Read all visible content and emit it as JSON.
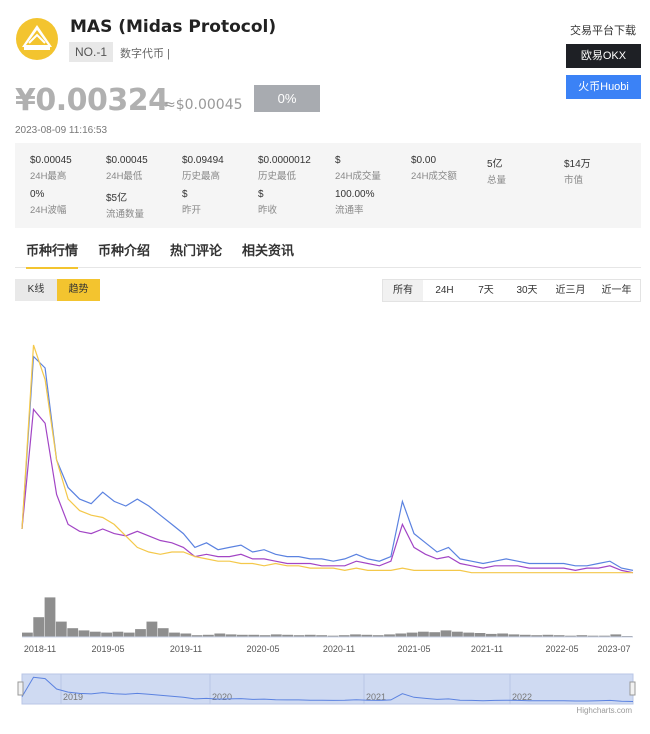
{
  "header": {
    "title": "MAS (Midas Protocol)",
    "rank": "NO.-1",
    "category": "数字代币 |"
  },
  "exchange": {
    "title": "交易平台下载",
    "okx": "欧易OKX",
    "huobi": "火币Huobi"
  },
  "price": {
    "cny": "¥0.00324",
    "usd": "≈$0.00045",
    "change": "0%",
    "timestamp": "2023-08-09 11:16:53"
  },
  "stats": [
    {
      "value": "$0.00045",
      "label": "24H最高"
    },
    {
      "value": "$0.00045",
      "label": "24H最低"
    },
    {
      "value": "$0.09494",
      "label": "历史最高"
    },
    {
      "value": "$0.0000012",
      "label": "历史最低"
    },
    {
      "value": "$",
      "label": "24H成交量"
    },
    {
      "value": "$0.00",
      "label": "24H成交额"
    },
    {
      "value": "5亿",
      "label": "总量"
    },
    {
      "value": "$14万",
      "label": "市值"
    },
    {
      "value": "0%",
      "label": "24H波幅"
    },
    {
      "value": "$5亿",
      "label": "流通数量"
    },
    {
      "value": "$",
      "label": "昨开"
    },
    {
      "value": "$",
      "label": "昨收"
    },
    {
      "value": "100.00%",
      "label": "流通率"
    }
  ],
  "tabs": [
    "币种行情",
    "币种介绍",
    "热门评论",
    "相关资讯"
  ],
  "controls": {
    "kline": "K线",
    "trend": "趋势",
    "ranges": [
      "所有",
      "24H",
      "7天",
      "30天",
      "近三月",
      "近一年"
    ]
  },
  "chart_data": {
    "type": "line",
    "x_tick_labels": [
      "2018-11",
      "2019-05",
      "2019-11",
      "2020-05",
      "2020-11",
      "2021-05",
      "2021-11",
      "2022-05",
      "2023-07"
    ],
    "navigator_labels": [
      "2019",
      "2020",
      "2021",
      "2022"
    ],
    "credit": "Highcharts.com",
    "colors": {
      "line1": "#5b82e0",
      "line2": "#a245c5",
      "line3": "#f4c84a",
      "volume": "#8e8e8e",
      "navigator": "#cfdaf2"
    },
    "series": [
      {
        "values": [
          0.2,
          0.95,
          0.9,
          0.5,
          0.38,
          0.33,
          0.31,
          0.36,
          0.32,
          0.3,
          0.33,
          0.3,
          0.26,
          0.22,
          0.18,
          0.12,
          0.14,
          0.11,
          0.12,
          0.13,
          0.1,
          0.11,
          0.09,
          0.08,
          0.08,
          0.07,
          0.07,
          0.06,
          0.07,
          0.09,
          0.07,
          0.06,
          0.08,
          0.32,
          0.18,
          0.14,
          0.1,
          0.12,
          0.07,
          0.06,
          0.05,
          0.06,
          0.07,
          0.06,
          0.05,
          0.05,
          0.05,
          0.05,
          0.04,
          0.04,
          0.05,
          0.06,
          0.03,
          0.02
        ]
      },
      {
        "values": [
          0.2,
          0.72,
          0.66,
          0.35,
          0.22,
          0.19,
          0.18,
          0.2,
          0.18,
          0.17,
          0.19,
          0.17,
          0.15,
          0.14,
          0.12,
          0.08,
          0.09,
          0.08,
          0.08,
          0.09,
          0.07,
          0.07,
          0.06,
          0.05,
          0.05,
          0.05,
          0.04,
          0.04,
          0.04,
          0.06,
          0.05,
          0.04,
          0.06,
          0.22,
          0.12,
          0.09,
          0.07,
          0.08,
          0.05,
          0.04,
          0.03,
          0.04,
          0.04,
          0.04,
          0.03,
          0.03,
          0.03,
          0.03,
          0.02,
          0.03,
          0.03,
          0.04,
          0.02,
          0.01
        ]
      },
      {
        "values": [
          0.2,
          1.0,
          0.85,
          0.5,
          0.33,
          0.28,
          0.26,
          0.25,
          0.22,
          0.17,
          0.12,
          0.1,
          0.09,
          0.1,
          0.1,
          0.08,
          0.07,
          0.06,
          0.06,
          0.05,
          0.05,
          0.04,
          0.05,
          0.04,
          0.04,
          0.03,
          0.03,
          0.03,
          0.02,
          0.03,
          0.02,
          0.02,
          0.02,
          0.03,
          0.02,
          0.02,
          0.02,
          0.02,
          0.02,
          0.01,
          0.01,
          0.01,
          0.01,
          0.01,
          0.01,
          0.01,
          0.01,
          0.01,
          0.01,
          0.01,
          0.01,
          0.01,
          0.01,
          0.01
        ]
      },
      {
        "values": [
          0.1,
          0.45,
          0.9,
          0.35,
          0.2,
          0.15,
          0.12,
          0.1,
          0.12,
          0.1,
          0.18,
          0.35,
          0.2,
          0.1,
          0.08,
          0.04,
          0.05,
          0.08,
          0.06,
          0.05,
          0.05,
          0.04,
          0.06,
          0.05,
          0.04,
          0.05,
          0.04,
          0.03,
          0.04,
          0.06,
          0.05,
          0.04,
          0.06,
          0.08,
          0.1,
          0.12,
          0.11,
          0.15,
          0.12,
          0.1,
          0.09,
          0.07,
          0.08,
          0.06,
          0.05,
          0.04,
          0.05,
          0.04,
          0.03,
          0.04,
          0.03,
          0.03,
          0.06,
          0.02
        ]
      }
    ]
  }
}
